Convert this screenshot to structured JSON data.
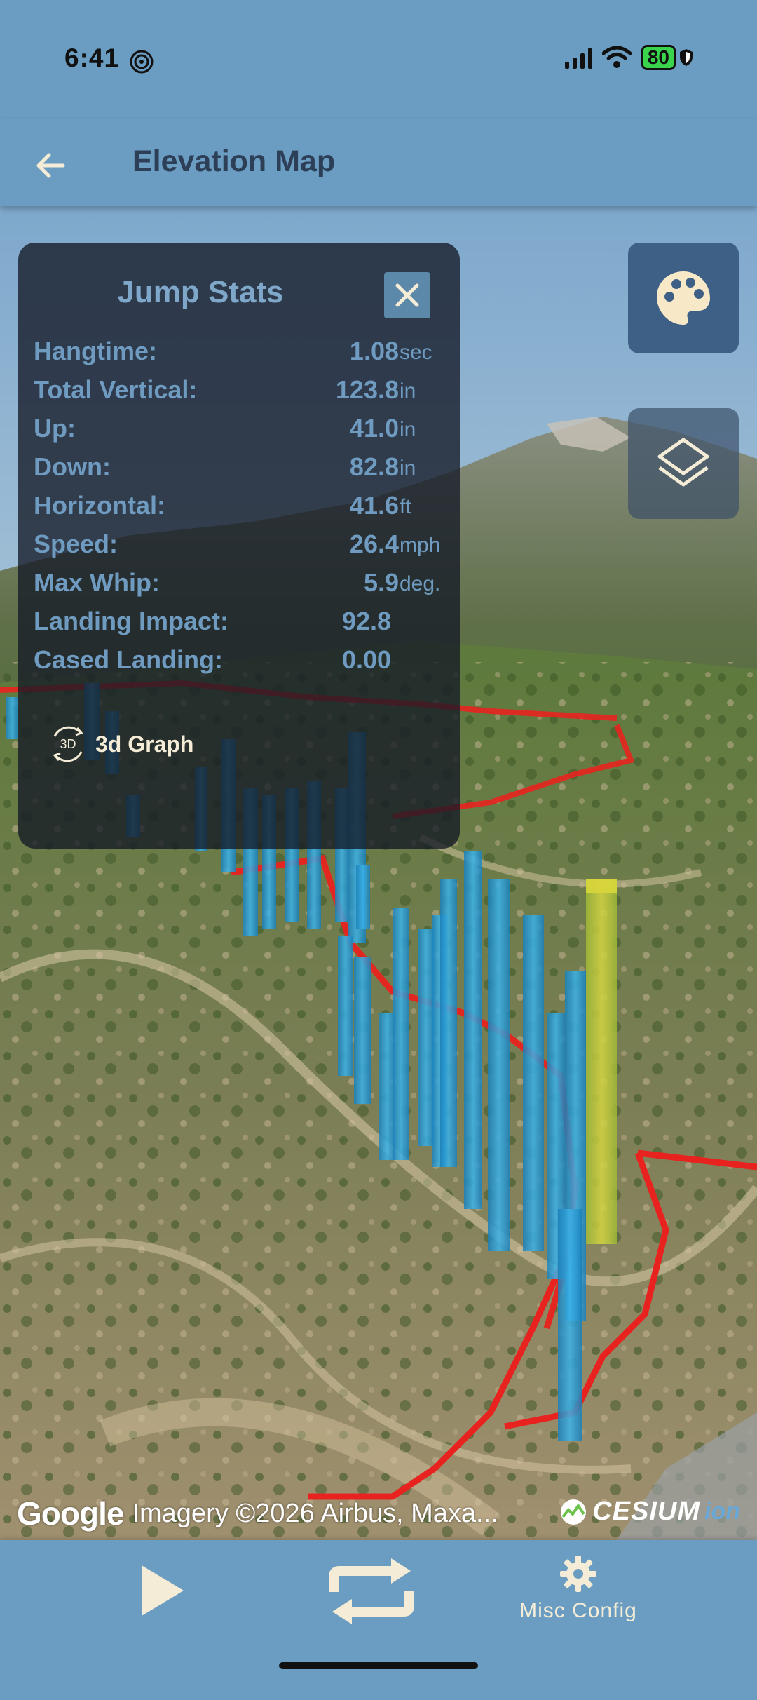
{
  "status_bar": {
    "time": "6:41",
    "battery": "80",
    "icons": [
      "spiral-icon",
      "signal-icon",
      "wifi-icon",
      "battery-icon",
      "shield-icon"
    ]
  },
  "app_bar": {
    "title": "Elevation Map",
    "back_icon": "arrow-left-icon"
  },
  "jump_stats": {
    "title": "Jump Stats",
    "close_icon": "close-icon",
    "rows": [
      {
        "label": "Hangtime:",
        "value": "1.08",
        "unit": "sec"
      },
      {
        "label": "Total Vertical:",
        "value": "123.8",
        "unit": "in"
      },
      {
        "label": "Up:",
        "value": "41.0",
        "unit": "in"
      },
      {
        "label": "Down:",
        "value": "82.8",
        "unit": "in"
      },
      {
        "label": "Horizontal:",
        "value": "41.6",
        "unit": "ft"
      },
      {
        "label": "Speed:",
        "value": "26.4",
        "unit": "mph"
      },
      {
        "label": "Max Whip:",
        "value": "5.9",
        "unit": "deg."
      },
      {
        "label": "Landing Impact:",
        "value": "92.8",
        "unit": ""
      },
      {
        "label": "Cased Landing:",
        "value": "0.00",
        "unit": ""
      }
    ],
    "graph_button": {
      "icon_text": "3D",
      "label": "3d Graph"
    }
  },
  "map_controls": {
    "palette_icon": "palette-icon",
    "layers_icon": "layers-icon"
  },
  "attribution": {
    "google": "Google",
    "imagery": "Imagery ©2026 Airbus, Maxa...",
    "cesium": "CESIUM",
    "ion": "ion"
  },
  "bottom_bar": {
    "play_icon": "play-icon",
    "repeat_icon": "repeat-icon",
    "misc_icon": "gear-icon",
    "misc_label": "Misc Config"
  },
  "colors": {
    "header": "#6a9dc1",
    "title_text": "#2d3e57",
    "panel_bg": "#141a26",
    "stat_text": "#6f9bc0",
    "accent_cream": "#f4ecd6",
    "track_red": "#e8231f",
    "bar_blue": "#2aa3e0",
    "bar_highlight": "#c9d23a"
  }
}
